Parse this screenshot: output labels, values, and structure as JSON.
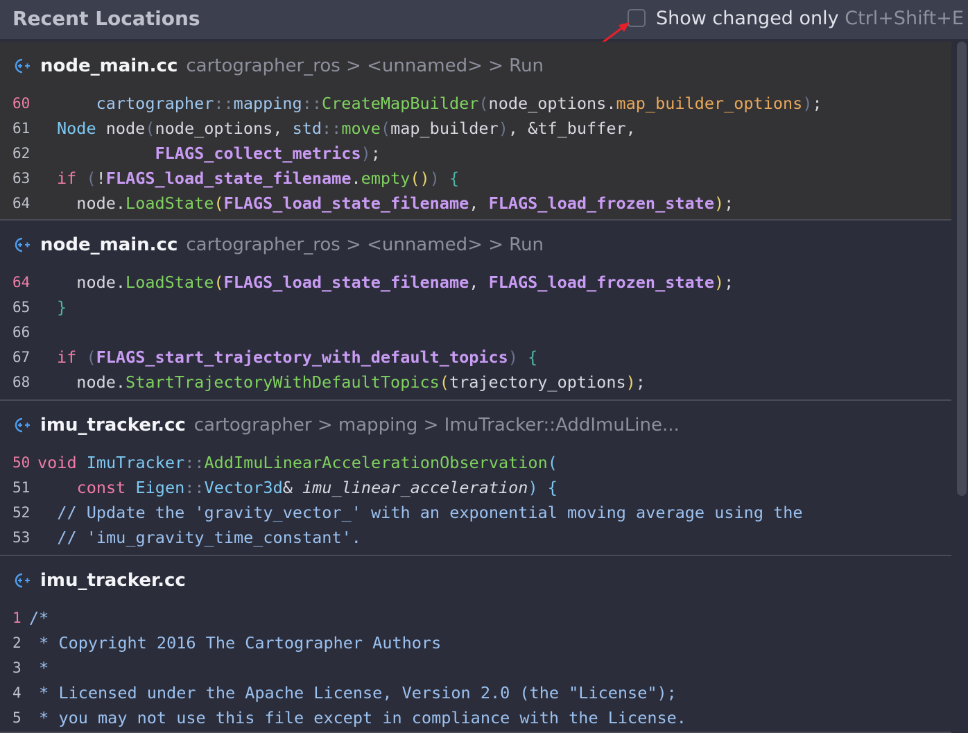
{
  "header": {
    "title": "Recent Locations",
    "checkbox_label": "Show changed only",
    "shortcut": "Ctrl+Shift+E",
    "checked": false
  },
  "colors": {
    "background": "#2b2d3a",
    "header_bg": "#3b3f4e",
    "selected_bg": "#333235",
    "highlight_line_number": "#f07fa8",
    "arrow": "#e8202a",
    "file_icon": "#4d9ef0"
  },
  "entries": [
    {
      "file": "node_main.cc",
      "breadcrumb": "cartographer_ros > <unnamed> > Run",
      "selected": true,
      "lines": [
        {
          "n": "60",
          "hl": true,
          "tokens": [
            {
              "t": "    "
            },
            {
              "t": "cartographer",
              "c": "ns"
            },
            {
              "t": "::",
              "c": "op"
            },
            {
              "t": "mapping",
              "c": "ns"
            },
            {
              "t": "::",
              "c": "op"
            },
            {
              "t": "CreateMapBuilder",
              "c": "fn"
            },
            {
              "t": "(",
              "c": "paren"
            },
            {
              "t": "node_options"
            },
            {
              "t": "."
            },
            {
              "t": "map_builder_options",
              "c": "field"
            },
            {
              "t": ")",
              "c": "paren"
            },
            {
              "t": ";"
            }
          ]
        },
        {
          "n": "61",
          "tokens": [
            {
              "t": "Node",
              "c": "type"
            },
            {
              "t": " node"
            },
            {
              "t": "(",
              "c": "paren"
            },
            {
              "t": "node_options, "
            },
            {
              "t": "std",
              "c": "ns"
            },
            {
              "t": "::",
              "c": "op"
            },
            {
              "t": "move",
              "c": "fn"
            },
            {
              "t": "(",
              "c": "paren"
            },
            {
              "t": "map_builder"
            },
            {
              "t": ")",
              "c": "paren"
            },
            {
              "t": ", &tf_buffer,"
            }
          ]
        },
        {
          "n": "62",
          "tokens": [
            {
              "t": "          "
            },
            {
              "t": "FLAGS_collect_metrics",
              "c": "flag"
            },
            {
              "t": ")",
              "c": "paren"
            },
            {
              "t": ";"
            }
          ]
        },
        {
          "n": "63",
          "tokens": [
            {
              "t": "if",
              "c": "kw"
            },
            {
              "t": " "
            },
            {
              "t": "(",
              "c": "paren"
            },
            {
              "t": "!"
            },
            {
              "t": "FLAGS_load_state_filename",
              "c": "flag"
            },
            {
              "t": "."
            },
            {
              "t": "empty",
              "c": "fn"
            },
            {
              "t": "()",
              "c": "pp"
            },
            {
              "t": ")",
              "c": "paren"
            },
            {
              "t": " "
            },
            {
              "t": "{",
              "c": "brace"
            }
          ]
        },
        {
          "n": "64",
          "tokens": [
            {
              "t": "  node."
            },
            {
              "t": "LoadState",
              "c": "fn"
            },
            {
              "t": "(",
              "c": "pp"
            },
            {
              "t": "FLAGS_load_state_filename",
              "c": "flag"
            },
            {
              "t": ", "
            },
            {
              "t": "FLAGS_load_frozen_state",
              "c": "flag"
            },
            {
              "t": ")",
              "c": "pp"
            },
            {
              "t": ";"
            }
          ]
        }
      ]
    },
    {
      "file": "node_main.cc",
      "breadcrumb": "cartographer_ros > <unnamed> > Run",
      "selected": false,
      "lines": [
        {
          "n": "64",
          "hl": true,
          "tokens": [
            {
              "t": "  node."
            },
            {
              "t": "LoadState",
              "c": "fn"
            },
            {
              "t": "(",
              "c": "pp"
            },
            {
              "t": "FLAGS_load_state_filename",
              "c": "flag"
            },
            {
              "t": ", "
            },
            {
              "t": "FLAGS_load_frozen_state",
              "c": "flag"
            },
            {
              "t": ")",
              "c": "pp"
            },
            {
              "t": ";"
            }
          ]
        },
        {
          "n": "65",
          "tokens": [
            {
              "t": "}",
              "c": "brace"
            }
          ]
        },
        {
          "n": "66",
          "tokens": []
        },
        {
          "n": "67",
          "tokens": [
            {
              "t": "if",
              "c": "kw"
            },
            {
              "t": " "
            },
            {
              "t": "(",
              "c": "paren"
            },
            {
              "t": "FLAGS_start_trajectory_with_default_topics",
              "c": "flag"
            },
            {
              "t": ")",
              "c": "paren"
            },
            {
              "t": " "
            },
            {
              "t": "{",
              "c": "brace"
            }
          ]
        },
        {
          "n": "68",
          "tokens": [
            {
              "t": "  node."
            },
            {
              "t": "StartTrajectoryWithDefaultTopics",
              "c": "fn"
            },
            {
              "t": "(",
              "c": "pp"
            },
            {
              "t": "trajectory_options"
            },
            {
              "t": ")",
              "c": "pp"
            },
            {
              "t": ";"
            }
          ]
        }
      ]
    },
    {
      "file": "imu_tracker.cc",
      "breadcrumb": "cartographer > mapping > ImuTracker::AddImuLine...",
      "selected": false,
      "lines": [
        {
          "n": "50",
          "hl": true,
          "tokens": [
            {
              "t": "void",
              "c": "kw"
            },
            {
              "t": " "
            },
            {
              "t": "ImuTracker",
              "c": "type"
            },
            {
              "t": "::",
              "c": "op"
            },
            {
              "t": "AddImuLinearAccelerationObservation",
              "c": "fn"
            },
            {
              "t": "(",
              "c": "type"
            }
          ]
        },
        {
          "n": "51",
          "tokens": [
            {
              "t": "    "
            },
            {
              "t": "const",
              "c": "kw"
            },
            {
              "t": " "
            },
            {
              "t": "Eigen",
              "c": "type"
            },
            {
              "t": "::",
              "c": "op"
            },
            {
              "t": "Vector3d",
              "c": "type"
            },
            {
              "t": "& "
            },
            {
              "t": "imu_linear_acceleration",
              "c": "param"
            },
            {
              "t": ")",
              "c": "type"
            },
            {
              "t": " "
            },
            {
              "t": "{",
              "c": "type"
            }
          ]
        },
        {
          "n": "52",
          "tokens": [
            {
              "t": "  "
            },
            {
              "t": "// Update the 'gravity_vector_' with an exponential moving average using the",
              "c": "comment"
            }
          ]
        },
        {
          "n": "53",
          "tokens": [
            {
              "t": "  "
            },
            {
              "t": "// 'imu_gravity_time_constant'.",
              "c": "comment"
            }
          ]
        }
      ]
    },
    {
      "file": "imu_tracker.cc",
      "breadcrumb": "",
      "selected": false,
      "lines": [
        {
          "n": "1",
          "hl": true,
          "tokens": [
            {
              "t": "/*",
              "c": "comment"
            }
          ]
        },
        {
          "n": "2",
          "tokens": [
            {
              "t": " * Copyright 2016 The Cartographer Authors",
              "c": "comment"
            }
          ]
        },
        {
          "n": "3",
          "tokens": [
            {
              "t": " *",
              "c": "comment"
            }
          ]
        },
        {
          "n": "4",
          "tokens": [
            {
              "t": " * Licensed under the Apache License, Version 2.0 (the \"License\");",
              "c": "comment"
            }
          ]
        },
        {
          "n": "5",
          "tokens": [
            {
              "t": " * you may not use this file except in compliance with the License.",
              "c": "comment"
            }
          ]
        }
      ]
    }
  ]
}
